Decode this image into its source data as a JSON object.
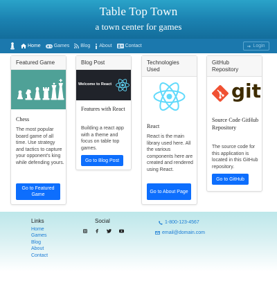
{
  "header": {
    "title": "Table Top Town",
    "subtitle": "a town center for games"
  },
  "nav": {
    "brand_icon": "chess-pawn-icon",
    "items": [
      {
        "label": "Home",
        "icon": "home-icon",
        "active": true
      },
      {
        "label": "Games",
        "icon": "gamepad-icon",
        "active": false
      },
      {
        "label": "Blog",
        "icon": "rss-icon",
        "active": false
      },
      {
        "label": "About",
        "icon": "info-icon",
        "active": false
      },
      {
        "label": "Contact",
        "icon": "address-card-icon",
        "active": false
      }
    ],
    "login_label": "Login"
  },
  "cards": [
    {
      "header": "Featured Game",
      "image": "chess-pieces-image",
      "title": "Chess",
      "text": "The most popular board game of all time. Use strategy and tactics to capture your opponent's king while defending yours.",
      "button": "Go to Featured Game"
    },
    {
      "header": "Blog Post",
      "image": "welcome-to-react-image",
      "image_text": "Welcome to React",
      "title": "Features with React",
      "text": "Building a react app with a theme and focus on table top games.",
      "button": "Go to Blog Post"
    },
    {
      "header": "Technologies Used",
      "image": "react-logo-image",
      "title": "React",
      "text": "React is the main library used here. All the various components here are created and rendered using React.",
      "button": "Go to About Page"
    },
    {
      "header": "GitHub Repository",
      "image": "git-logo-image",
      "image_text": "git",
      "title": "Source Code GitHub Repository",
      "text": "The source code for this application is located in this GitHub repository.",
      "button": "Go to GitHub"
    }
  ],
  "footer": {
    "links_heading": "Links",
    "links": [
      "Home",
      "Games",
      "Blog",
      "About",
      "Contact"
    ],
    "social_heading": "Social",
    "social_icons": [
      "instagram-icon",
      "facebook-icon",
      "twitter-icon",
      "youtube-icon"
    ],
    "phone": "1-800-123-4567",
    "email": "email@domain.com"
  },
  "colors": {
    "header_gradient_top": "#2aa3c9",
    "navbar": "#1b78ad",
    "button_primary": "#0d6efd",
    "link": "#1a7bd4",
    "react_blue": "#61dafb",
    "git_orange": "#f05133",
    "chess_bg": "#4fa197"
  }
}
